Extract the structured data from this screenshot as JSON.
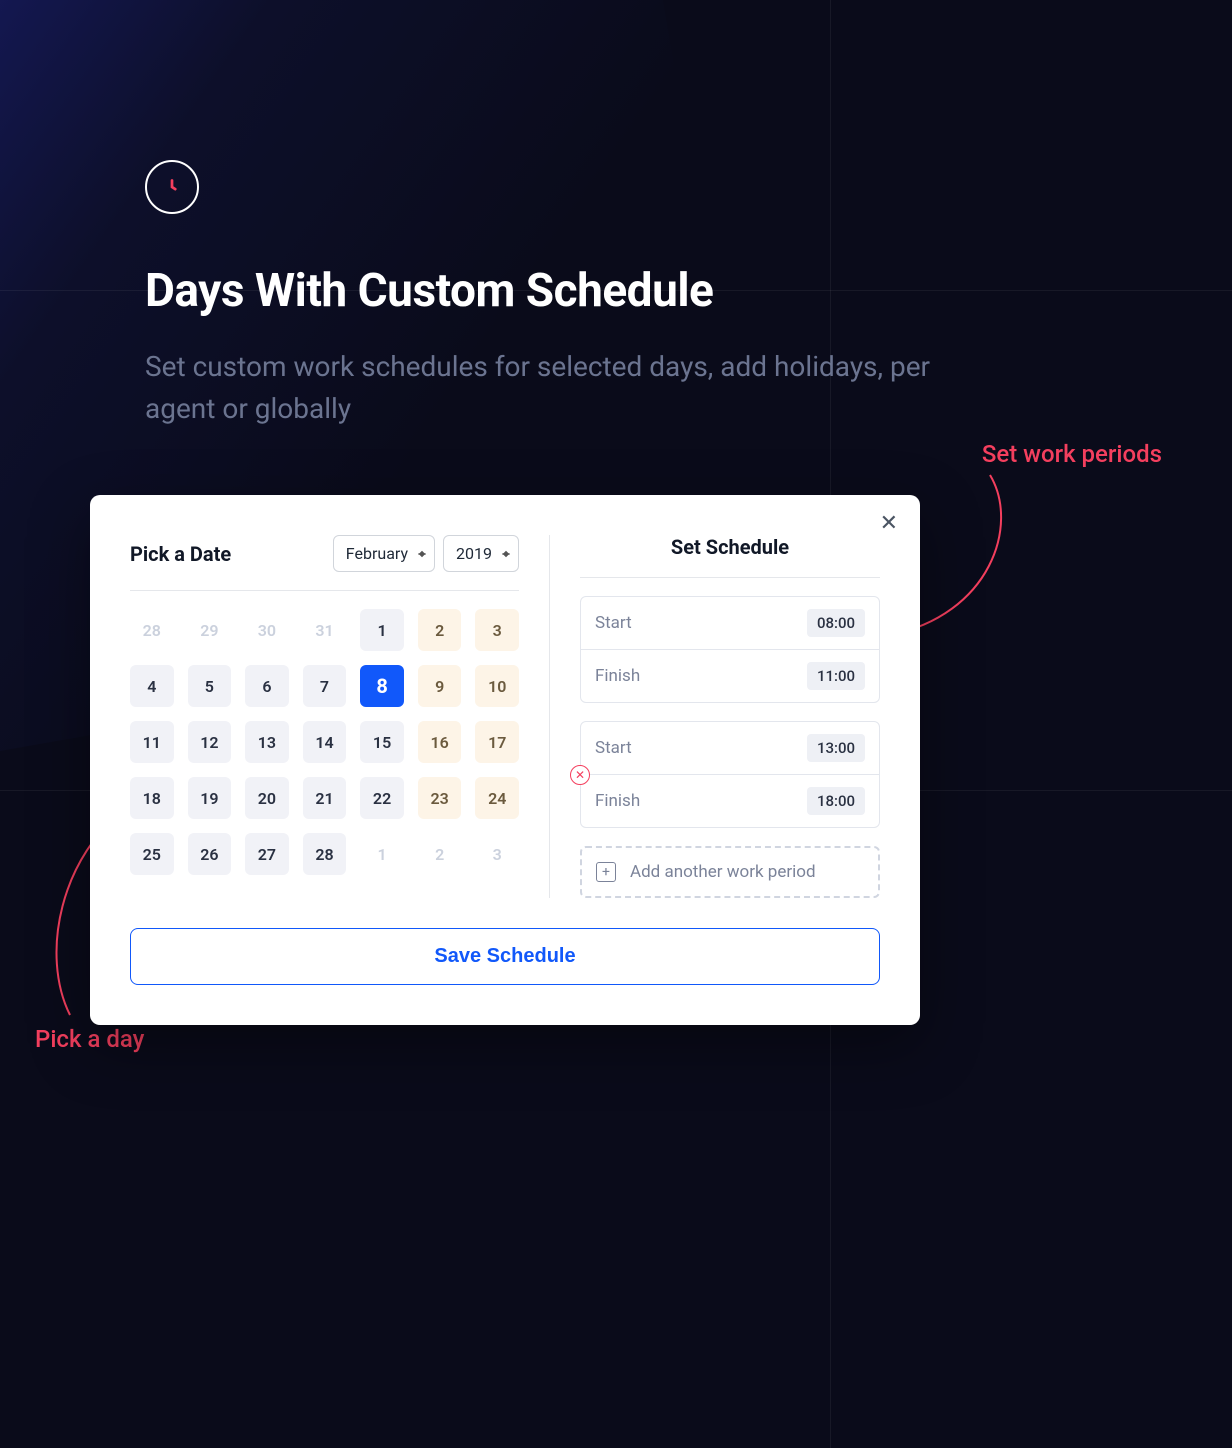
{
  "header": {
    "title": "Days With Custom Schedule",
    "subtitle": "Set custom work schedules for selected days, add holidays, per agent or globally"
  },
  "annotations": {
    "top": "Set work periods",
    "bottom": "Pick a day"
  },
  "dialog": {
    "pick_date_title": "Pick a Date",
    "set_schedule_title": "Set Schedule",
    "month": "February",
    "year": "2019",
    "save_label": "Save Schedule",
    "add_period_label": "Add another work period",
    "start_label": "Start",
    "finish_label": "Finish"
  },
  "calendar": {
    "cells": [
      {
        "n": "28",
        "kind": "outside"
      },
      {
        "n": "29",
        "kind": "outside"
      },
      {
        "n": "30",
        "kind": "outside"
      },
      {
        "n": "31",
        "kind": "outside"
      },
      {
        "n": "1",
        "kind": "normal"
      },
      {
        "n": "2",
        "kind": "weekend"
      },
      {
        "n": "3",
        "kind": "weekend"
      },
      {
        "n": "4",
        "kind": "normal"
      },
      {
        "n": "5",
        "kind": "normal"
      },
      {
        "n": "6",
        "kind": "normal"
      },
      {
        "n": "7",
        "kind": "normal"
      },
      {
        "n": "8",
        "kind": "selected"
      },
      {
        "n": "9",
        "kind": "weekend"
      },
      {
        "n": "10",
        "kind": "weekend"
      },
      {
        "n": "11",
        "kind": "normal"
      },
      {
        "n": "12",
        "kind": "normal"
      },
      {
        "n": "13",
        "kind": "normal"
      },
      {
        "n": "14",
        "kind": "normal"
      },
      {
        "n": "15",
        "kind": "normal"
      },
      {
        "n": "16",
        "kind": "weekend"
      },
      {
        "n": "17",
        "kind": "weekend"
      },
      {
        "n": "18",
        "kind": "normal"
      },
      {
        "n": "19",
        "kind": "normal"
      },
      {
        "n": "20",
        "kind": "normal"
      },
      {
        "n": "21",
        "kind": "normal"
      },
      {
        "n": "22",
        "kind": "normal"
      },
      {
        "n": "23",
        "kind": "weekend"
      },
      {
        "n": "24",
        "kind": "weekend"
      },
      {
        "n": "25",
        "kind": "normal"
      },
      {
        "n": "26",
        "kind": "normal"
      },
      {
        "n": "27",
        "kind": "normal"
      },
      {
        "n": "28",
        "kind": "normal"
      },
      {
        "n": "1",
        "kind": "outside"
      },
      {
        "n": "2",
        "kind": "outside"
      },
      {
        "n": "3",
        "kind": "outside"
      }
    ]
  },
  "periods": [
    {
      "start": "08:00",
      "finish": "11:00",
      "removable": false
    },
    {
      "start": "13:00",
      "finish": "18:00",
      "removable": true
    }
  ],
  "colors": {
    "accent": "#1158fa",
    "annotation": "#f43f5e"
  }
}
